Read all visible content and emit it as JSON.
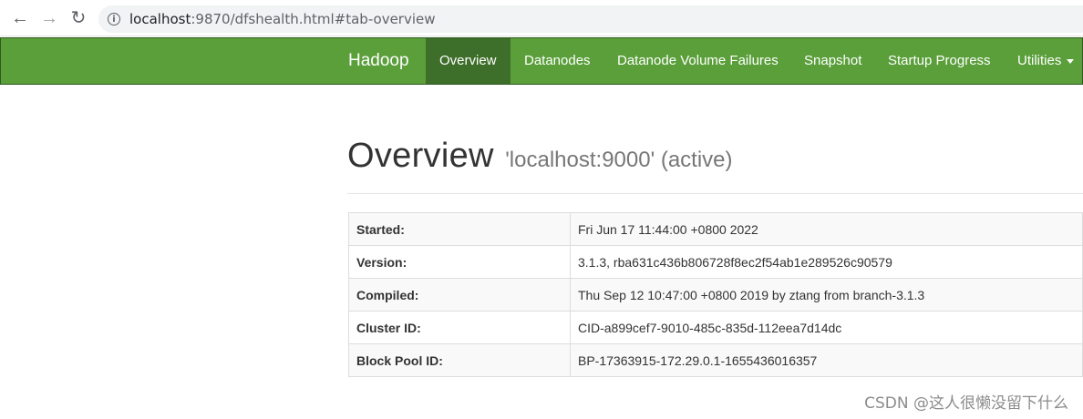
{
  "browser": {
    "url_host": "localhost",
    "url_rest": ":9870/dfshealth.html#tab-overview"
  },
  "navbar": {
    "brand": "Hadoop",
    "items": [
      {
        "label": "Overview",
        "active": true
      },
      {
        "label": "Datanodes",
        "active": false
      },
      {
        "label": "Datanode Volume Failures",
        "active": false
      },
      {
        "label": "Snapshot",
        "active": false
      },
      {
        "label": "Startup Progress",
        "active": false
      },
      {
        "label": "Utilities",
        "active": false,
        "dropdown": true
      }
    ],
    "color": "#5a9f3a",
    "active_color": "#3e6f2a"
  },
  "page": {
    "title": "Overview",
    "subtitle": "'localhost:9000' (active)"
  },
  "table": {
    "rows": [
      {
        "label": "Started:",
        "value": "Fri Jun 17 11:44:00 +0800 2022"
      },
      {
        "label": "Version:",
        "value": "3.1.3, rba631c436b806728f8ec2f54ab1e289526c90579"
      },
      {
        "label": "Compiled:",
        "value": "Thu Sep 12 10:47:00 +0800 2019 by ztang from branch-3.1.3"
      },
      {
        "label": "Cluster ID:",
        "value": "CID-a899cef7-9010-485c-835d-112eea7d14dc"
      },
      {
        "label": "Block Pool ID:",
        "value": "BP-17363915-172.29.0.1-1655436016357"
      }
    ]
  },
  "watermark": "CSDN @这人很懒没留下什么",
  "icons": {
    "back": "arrow-left-icon",
    "forward": "arrow-right-icon",
    "reload": "reload-icon",
    "info": "info-icon"
  }
}
